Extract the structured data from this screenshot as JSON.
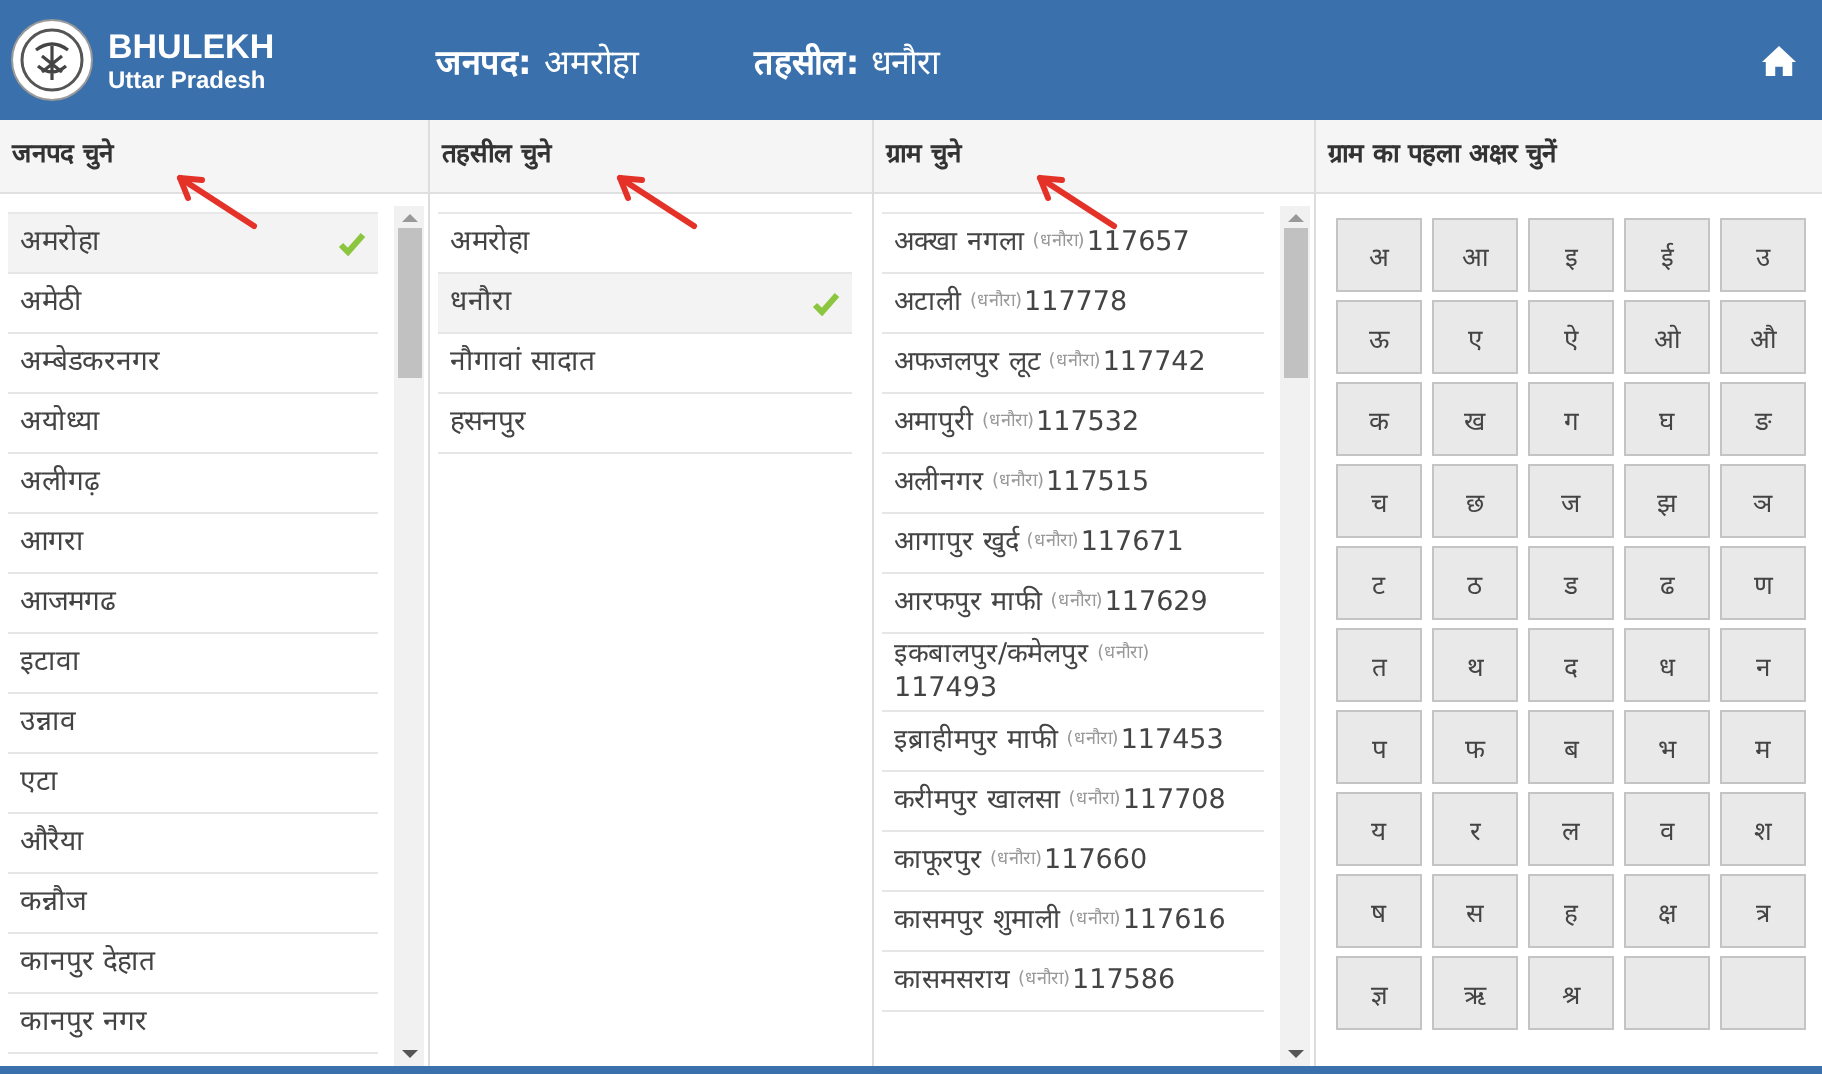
{
  "header": {
    "brand_title": "BHULEKH",
    "brand_subtitle": "Uttar Pradesh",
    "fields": [
      {
        "label": "जनपद:",
        "value": "अमरोहा"
      },
      {
        "label": "तहसील:",
        "value": "धनौरा"
      }
    ]
  },
  "panels": [
    {
      "kind": "list",
      "title": "जनपद चुने",
      "items": [
        {
          "name": "अमरोहा",
          "selected": true
        },
        {
          "name": "अमेठी",
          "selected": false
        },
        {
          "name": "अम्बेडकरनगर",
          "selected": false
        },
        {
          "name": "अयोध्या",
          "selected": false
        },
        {
          "name": "अलीगढ़",
          "selected": false
        },
        {
          "name": "आगरा",
          "selected": false
        },
        {
          "name": "आजमगढ",
          "selected": false
        },
        {
          "name": "इटावा",
          "selected": false
        },
        {
          "name": "उन्नाव",
          "selected": false
        },
        {
          "name": "एटा",
          "selected": false
        },
        {
          "name": "औरैया",
          "selected": false
        },
        {
          "name": "कन्नौज",
          "selected": false
        },
        {
          "name": "कानपुर देहात",
          "selected": false
        },
        {
          "name": "कानपुर नगर",
          "selected": false
        }
      ]
    },
    {
      "kind": "list",
      "title": "तहसील चुने",
      "items": [
        {
          "name": "अमरोहा",
          "selected": false
        },
        {
          "name": "धनौरा",
          "selected": true
        },
        {
          "name": "नौगावां सादात",
          "selected": false
        },
        {
          "name": "हसनपुर",
          "selected": false
        }
      ]
    },
    {
      "kind": "villages",
      "title": "ग्राम चुने",
      "items": [
        {
          "name": "अक्खा नगला",
          "tehsil": "(धनौरा)",
          "code": "117657",
          "selected": false
        },
        {
          "name": "अटाली",
          "tehsil": "(धनौरा)",
          "code": "117778",
          "selected": false
        },
        {
          "name": "अफजलपुर लूट",
          "tehsil": "(धनौरा)",
          "code": "117742",
          "selected": false
        },
        {
          "name": "अमापुरी",
          "tehsil": "(धनौरा)",
          "code": "117532",
          "selected": false
        },
        {
          "name": "अलीनगर",
          "tehsil": "(धनौरा)",
          "code": "117515",
          "selected": false
        },
        {
          "name": "आगापुर खुर्द",
          "tehsil": "(धनौरा)",
          "code": "117671",
          "selected": false
        },
        {
          "name": "आरफपुर माफी",
          "tehsil": "(धनौरा)",
          "code": "117629",
          "selected": false
        },
        {
          "name": "इकबालपुर/कमेलपुर",
          "tehsil": "(धनौरा)",
          "code": "117493",
          "selected": false
        },
        {
          "name": "इब्राहीमपुर माफी",
          "tehsil": "(धनौरा)",
          "code": "117453",
          "selected": false
        },
        {
          "name": "करीमपुर खालसा",
          "tehsil": "(धनौरा)",
          "code": "117708",
          "selected": false
        },
        {
          "name": "काफूरपुर",
          "tehsil": "(धनौरा)",
          "code": "117660",
          "selected": false
        },
        {
          "name": "कासमपुर शुमाली",
          "tehsil": "(धनौरा)",
          "code": "117616",
          "selected": false
        },
        {
          "name": "कासमसराय",
          "tehsil": "(धनौरा)",
          "code": "117586",
          "selected": false
        }
      ]
    },
    {
      "kind": "letters",
      "title": "ग्राम का पहला अक्षर चुनें",
      "letters": [
        "अ",
        "आ",
        "इ",
        "ई",
        "उ",
        "ऊ",
        "ए",
        "ऐ",
        "ओ",
        "औ",
        "क",
        "ख",
        "ग",
        "घ",
        "ङ",
        "च",
        "छ",
        "ज",
        "झ",
        "ञ",
        "ट",
        "ठ",
        "ड",
        "ढ",
        "ण",
        "त",
        "थ",
        "द",
        "ध",
        "न",
        "प",
        "फ",
        "ब",
        "भ",
        "म",
        "य",
        "र",
        "ल",
        "व",
        "श",
        "ष",
        "स",
        "ह",
        "क्ष",
        "त्र",
        "ज्ञ",
        "ऋ",
        "श्र"
      ]
    }
  ]
}
